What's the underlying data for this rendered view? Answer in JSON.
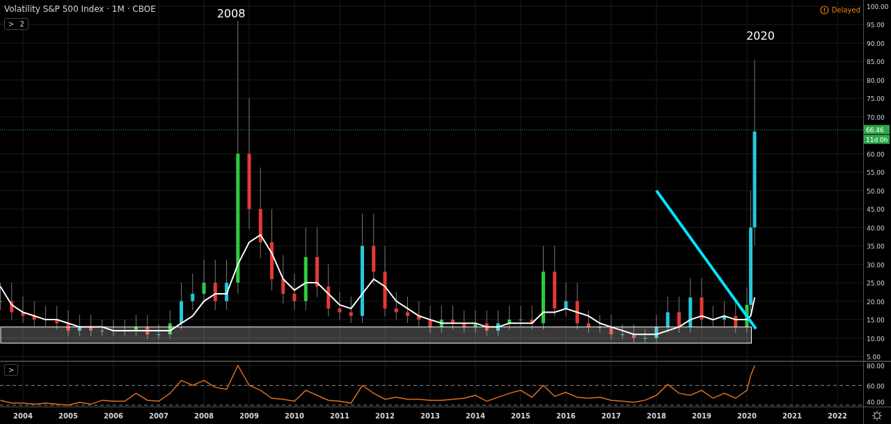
{
  "header": {
    "title": "Volatility S&P 500 Index · 1M · CBOE",
    "collapse_button": {
      "arrow": ">",
      "count": "2"
    }
  },
  "status": {
    "text": "Delayed"
  },
  "price_chart": {
    "year_labels": [
      "2008",
      "2020"
    ],
    "price_axis": [
      "100.00",
      "95.00",
      "90.00",
      "85.00",
      "80.00",
      "75.00",
      "70.00",
      "60.00",
      "55.00",
      "50.00",
      "45.00",
      "40.00",
      "35.00",
      "30.00",
      "25.00",
      "20.00",
      "15.00",
      "10.00",
      "5.00"
    ],
    "last_price": {
      "value": "66.46",
      "countdown": "11d 0h"
    }
  },
  "rsi_chart": {
    "collapse_button": {
      "arrow": ">"
    },
    "value_axis": [
      "80.00",
      "60.00",
      "40.00"
    ]
  },
  "time_axis": [
    "2004",
    "2005",
    "2006",
    "2007",
    "2008",
    "2009",
    "2010",
    "2011",
    "2012",
    "2013",
    "2014",
    "2015",
    "2016",
    "2017",
    "2018",
    "2019",
    "2020",
    "2021",
    "2022"
  ]
}
